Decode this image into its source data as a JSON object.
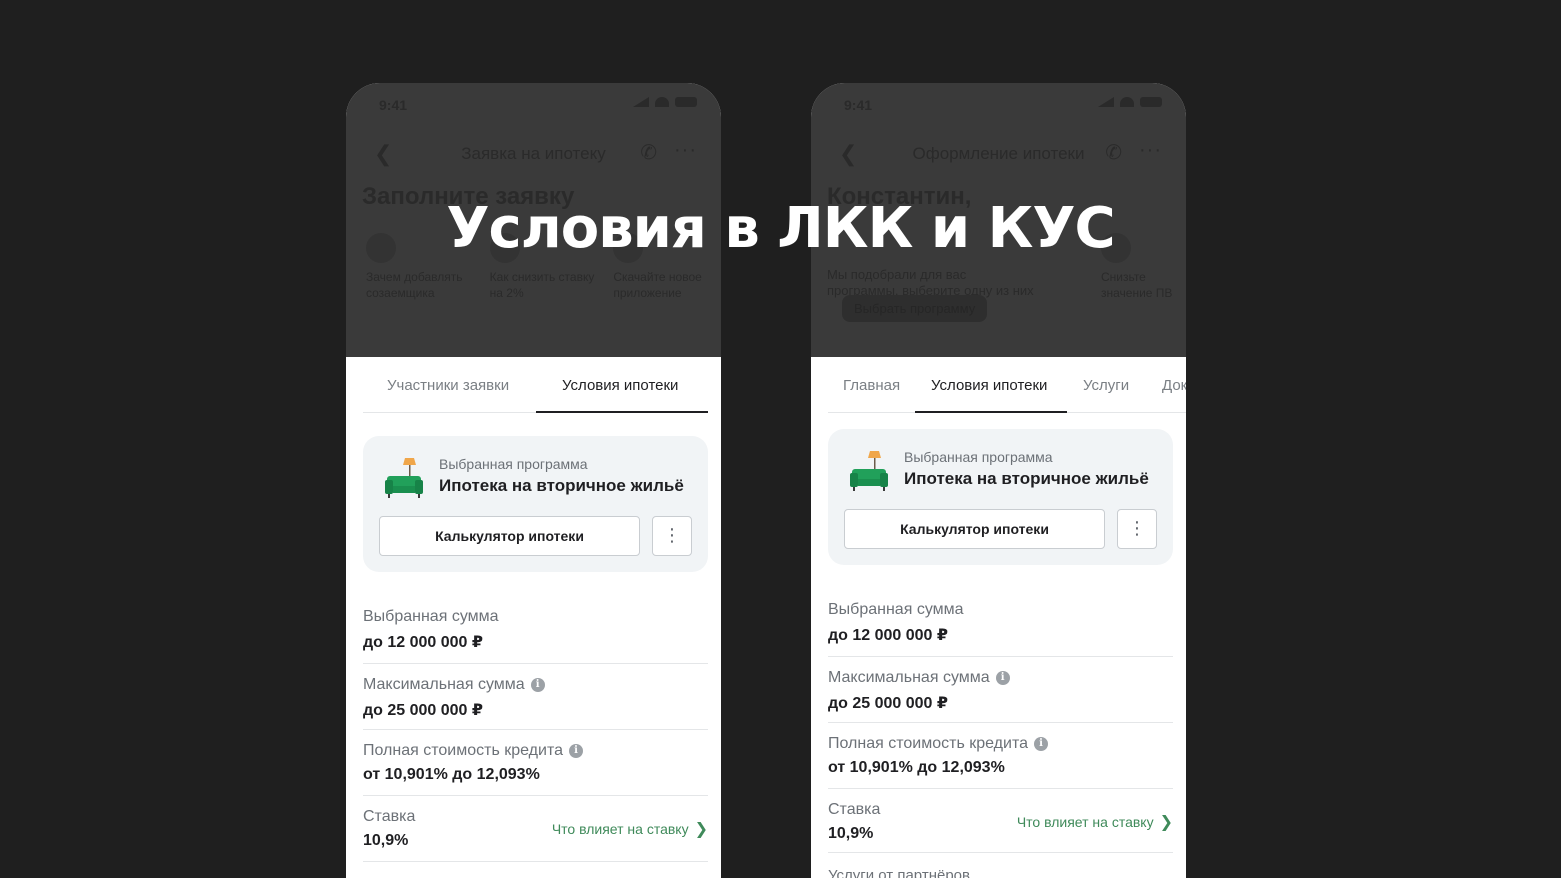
{
  "headline": "Условия в ЛКК и КУС",
  "left": {
    "status_time": "9:41",
    "nav_title": "Заявка на ипотеку",
    "dim_heading": "Заполните заявку",
    "dim_stories": [
      "Зачем добавлять созаемщика",
      "Как снизить ставку на 2%",
      "Скачайте новое приложение"
    ],
    "tabs": [
      "Участники заявки",
      "Условия ипотеки"
    ],
    "active_tab": "Условия ипотеки",
    "card": {
      "caption": "Выбранная программа",
      "title": "Ипотека на вторичное жильё",
      "calc_button": "Калькулятор ипотеки",
      "more_icon": "more-vertical-icon"
    },
    "rows": [
      {
        "label": "Выбранная сумма",
        "value": "до 12 000 000 ₽"
      },
      {
        "label": "Максимальная сумма",
        "value": "до 25 000 000 ₽",
        "info": true
      },
      {
        "label": "Полная стоимость кредита",
        "value": "от 10,901% до 12,093%",
        "info": true
      },
      {
        "label": "Ставка",
        "value": "10,9%",
        "link": "Что влияет на ставку"
      }
    ]
  },
  "right": {
    "status_time": "9:41",
    "nav_title": "Оформление ипотеки",
    "dim_heading": "Константин,",
    "dim_sub": "Мы подобрали для вас программы, выберите одну из них",
    "dim_button": "Выбрать программу",
    "dim_story": "Снизьте значение ПВ",
    "tabs": [
      "Главная",
      "Условия ипотеки",
      "Услуги",
      "Док"
    ],
    "active_tab": "Условия ипотеки",
    "card": {
      "caption": "Выбранная программа",
      "title": "Ипотека на вторичное жильё",
      "calc_button": "Калькулятор ипотеки",
      "more_icon": "more-vertical-icon"
    },
    "rows": [
      {
        "label": "Выбранная сумма",
        "value": "до 12 000 000 ₽"
      },
      {
        "label": "Максимальная сумма",
        "value": "до 25 000 000 ₽",
        "info": true
      },
      {
        "label": "Полная стоимость кредита",
        "value": "от 10,901% до 12,093%",
        "info": true
      },
      {
        "label": "Ставка",
        "value": "10,9%",
        "link": "Что влияет на ставку"
      }
    ],
    "partial_row_label": "Услуги от партнёров"
  },
  "colors": {
    "background": "#1f1f1f",
    "accent_green": "#3f8a5a",
    "card_bg": "#f1f4f6"
  }
}
